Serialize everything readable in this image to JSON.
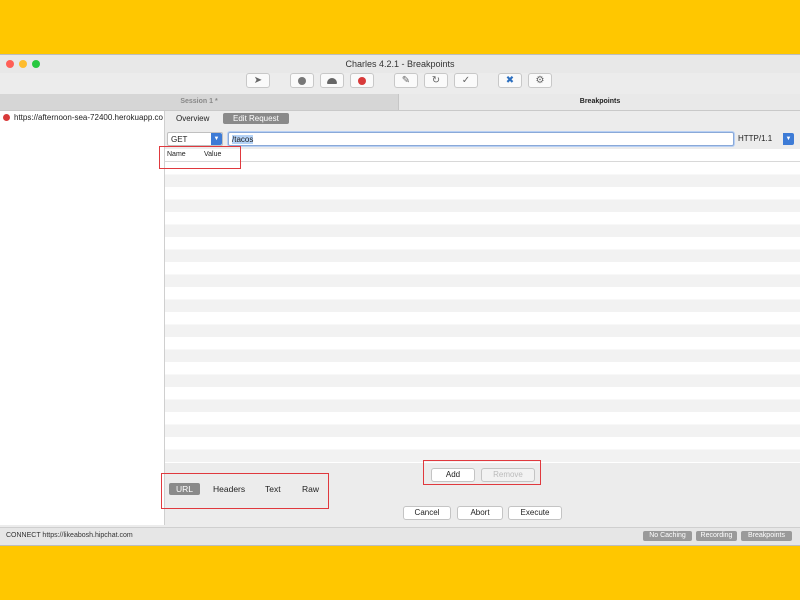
{
  "window": {
    "title": "Charles 4.2.1 - Breakpoints"
  },
  "toolbar": {
    "icons": [
      "broom-icon",
      "record-icon",
      "turtle-icon",
      "breakpoint-icon",
      "pen-icon",
      "refresh-icon",
      "checkmark-icon",
      "tools-icon",
      "settings-icon"
    ]
  },
  "tabs": {
    "session": "Session 1 *",
    "breakpoints": "Breakpoints"
  },
  "sidebar": {
    "items": [
      {
        "label": "https://afternoon-sea-72400.herokuapp.com"
      }
    ]
  },
  "subtabs": {
    "overview": "Overview",
    "edit_request": "Edit Request"
  },
  "request": {
    "method": "GET",
    "path": "/tacos",
    "protocol": "HTTP/1.1"
  },
  "table": {
    "columns": [
      "Name",
      "Value"
    ]
  },
  "actions": {
    "add": "Add",
    "remove": "Remove"
  },
  "views": [
    "URL",
    "Headers",
    "Text",
    "Raw"
  ],
  "execute_bar": {
    "cancel": "Cancel",
    "abort": "Abort",
    "execute": "Execute"
  },
  "status": {
    "text": "CONNECT https://likeabosh.hipchat.com",
    "no_caching": "No Caching",
    "recording": "Recording",
    "breakpoints": "Breakpoints"
  },
  "colors": {
    "highlight_box": "#e0393e",
    "background": "#FFC700",
    "selected_tab": "#8a8a8a"
  }
}
